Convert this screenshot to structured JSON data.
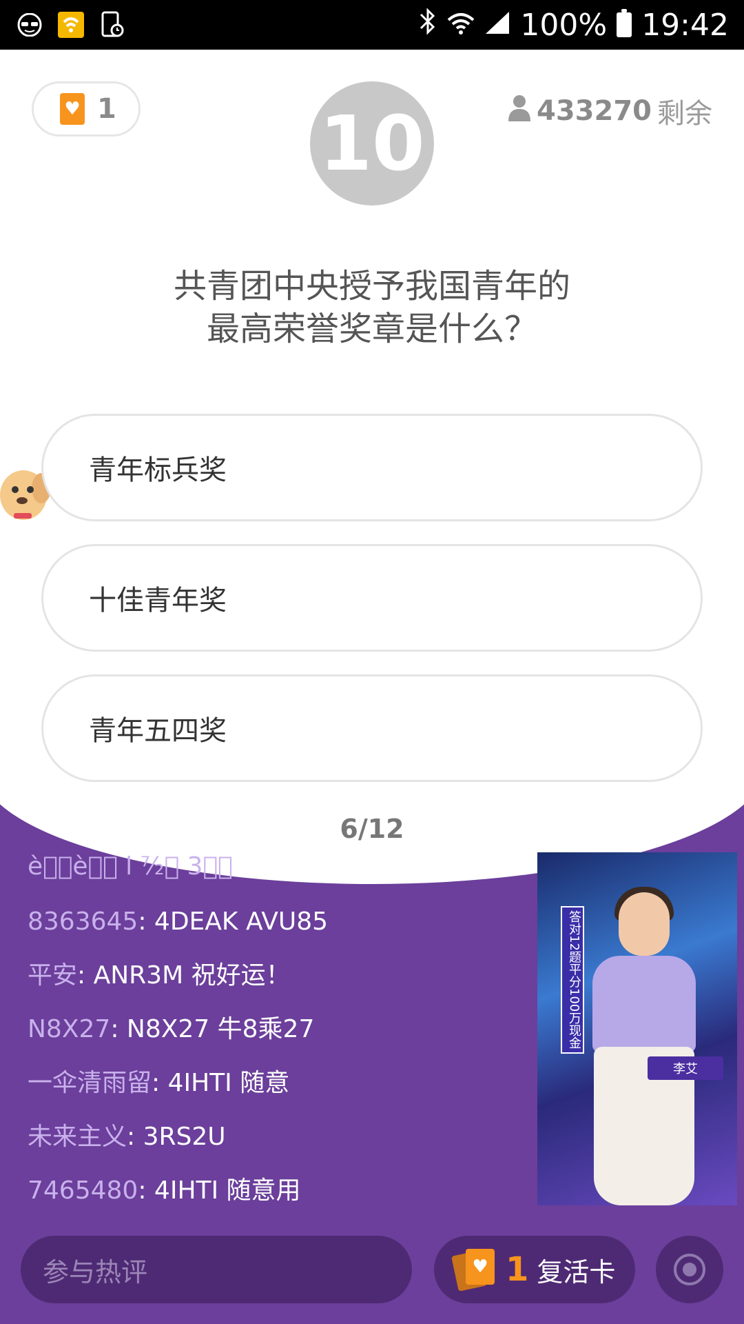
{
  "status_bar": {
    "battery_percent": "100%",
    "time": "19:42",
    "icons": [
      "incognito-icon",
      "wifi-app-icon",
      "screen-lock-icon",
      "bluetooth-icon",
      "wifi-icon",
      "signal-icon",
      "battery-icon"
    ]
  },
  "quiz": {
    "lives": "1",
    "timer": "10",
    "remaining_count": "433270",
    "remaining_label": "剩余",
    "question_line1": "共青团中央授予我国青年的",
    "question_line2": "最高荣誉奖章是什么？",
    "options": [
      "青年标兵奖",
      "十佳青年奖",
      "青年五四奖"
    ],
    "progress_current": "6",
    "progress_total": "/12"
  },
  "chat": {
    "partial_line": "è\u0000\u0000è\u0000\u0000 l ⁷⁄₂\u0000 3\u0000\u0000",
    "messages": [
      {
        "user": "8363645",
        "text": ":  4DEAK  AVU85"
      },
      {
        "user": "平安",
        "text": ": ANR3M 祝好运！"
      },
      {
        "user": "N8X27",
        "text": ": N8X27 牛8乘27"
      },
      {
        "user": "一伞清雨留",
        "text": ": 4IHTI 随意"
      },
      {
        "user": "未来主义",
        "text": ": 3RS2U"
      },
      {
        "user": "7465480",
        "text": ": 4IHTI 随意用"
      }
    ]
  },
  "video": {
    "banner_text": "答对12题平分100万现金",
    "name_tag": "李艾"
  },
  "bottom_bar": {
    "comment_placeholder": "参与热评",
    "revive_count": "1",
    "revive_label": "复活卡"
  },
  "colors": {
    "purple_bg": "#6b3f9b",
    "orange_accent": "#f7941d",
    "timer_gray": "#c8c8c8"
  }
}
